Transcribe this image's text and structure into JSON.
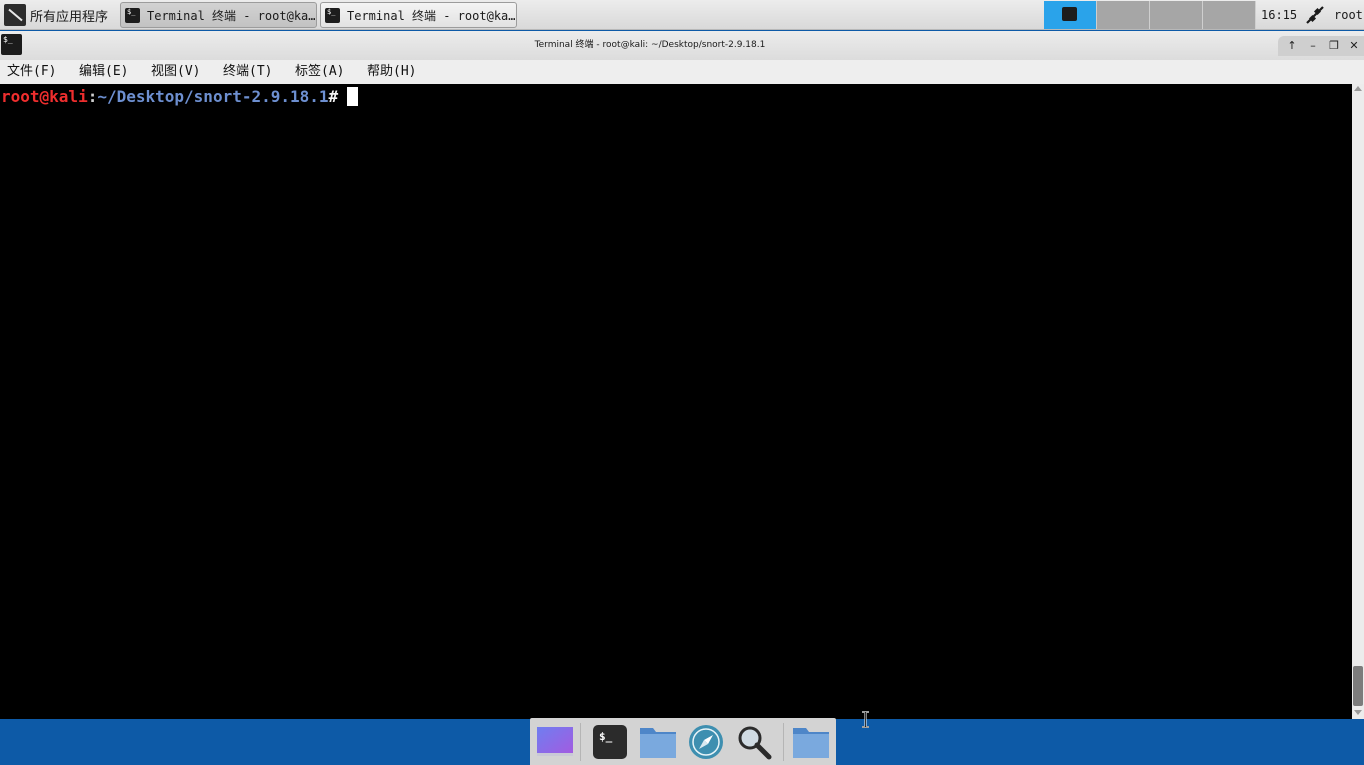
{
  "panel": {
    "apps_menu_label": "所有应用程序",
    "tasks": [
      {
        "label": "Terminal 终端 - root@ka…",
        "active": true
      },
      {
        "label": "Terminal 终端 - root@ka…",
        "active": false
      }
    ],
    "workspaces": [
      {
        "name": "workspace-1",
        "current": true
      },
      {
        "name": "workspace-2",
        "current": false
      },
      {
        "name": "workspace-3",
        "current": false
      },
      {
        "name": "workspace-4",
        "current": false
      }
    ],
    "clock": "16:15",
    "network_icon": "network-disconnected-icon",
    "user": "root"
  },
  "window": {
    "title": "Terminal 终端 - root@kali: ~/Desktop/snort-2.9.18.1",
    "icon_glyph": "$_",
    "buttons": [
      "↑",
      "–",
      "❐",
      "✕"
    ],
    "menu": [
      "文件(F)",
      "编辑(E)",
      "视图(V)",
      "终端(T)",
      "标签(A)",
      "帮助(H)"
    ]
  },
  "terminal": {
    "prompt_user": "root@kali",
    "prompt_colon": ":",
    "prompt_path": "~/Desktop/snort-2.9.18.1",
    "prompt_symbol": "#"
  },
  "dock": {
    "items": [
      "desktop-icon",
      "terminal-icon",
      "file-manager-icon",
      "web-browser-icon",
      "app-finder-icon",
      "folder-icon"
    ]
  },
  "colors": {
    "desktop": "#0d5aa7",
    "prompt_user": "#ee2e2e",
    "prompt_path": "#6d8fd0",
    "workspace_active": "#2aa3ea"
  }
}
